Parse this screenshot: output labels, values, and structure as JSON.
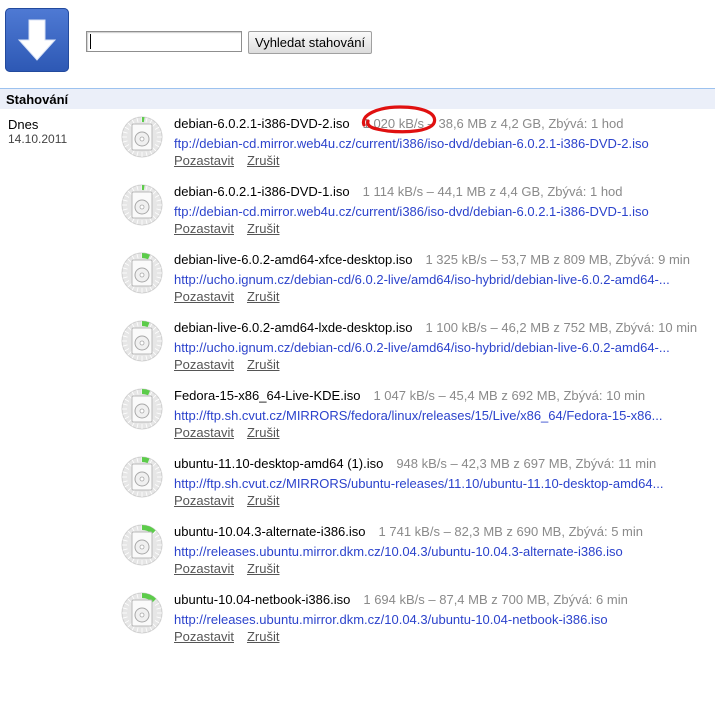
{
  "search": {
    "value": "",
    "button_label": "Vyhledat stahování"
  },
  "section": {
    "title": "Stahování"
  },
  "date_group": {
    "label": "Dnes",
    "date": "14.10.2011"
  },
  "progress_color": "#5ccc4a",
  "annotation_color": "#e01010",
  "downloads": [
    {
      "filename": "debian-6.0.2.1-i386-DVD-2.iso",
      "status": "1 020 kB/s – 38,6 MB z 4,2 GB, Zbývá: 1 hod",
      "url": "ftp://debian-cd.mirror.web4u.cz/current/i386/iso-dvd/debian-6.0.2.1-i386-DVD-2.iso",
      "pause_label": "Pozastavit",
      "cancel_label": "Zrušit",
      "progress": 0.009
    },
    {
      "filename": "debian-6.0.2.1-i386-DVD-1.iso",
      "status": "1 114 kB/s – 44,1 MB z 4,4 GB, Zbývá: 1 hod",
      "url": "ftp://debian-cd.mirror.web4u.cz/current/i386/iso-dvd/debian-6.0.2.1-i386-DVD-1.iso",
      "pause_label": "Pozastavit",
      "cancel_label": "Zrušit",
      "progress": 0.01
    },
    {
      "filename": "debian-live-6.0.2-amd64-xfce-desktop.iso",
      "status": "1 325 kB/s – 53,7 MB z 809 MB, Zbývá: 9 min",
      "url": "http://ucho.ignum.cz/debian-cd/6.0.2-live/amd64/iso-hybrid/debian-live-6.0.2-amd64-...",
      "pause_label": "Pozastavit",
      "cancel_label": "Zrušit",
      "progress": 0.066
    },
    {
      "filename": "debian-live-6.0.2-amd64-lxde-desktop.iso",
      "status": "1 100 kB/s – 46,2 MB z 752 MB, Zbývá: 10 min",
      "url": "http://ucho.ignum.cz/debian-cd/6.0.2-live/amd64/iso-hybrid/debian-live-6.0.2-amd64-...",
      "pause_label": "Pozastavit",
      "cancel_label": "Zrušit",
      "progress": 0.061
    },
    {
      "filename": "Fedora-15-x86_64-Live-KDE.iso",
      "status": "1 047 kB/s – 45,4 MB z 692 MB, Zbývá: 10 min",
      "url": "http://ftp.sh.cvut.cz/MIRRORS/fedora/linux/releases/15/Live/x86_64/Fedora-15-x86...",
      "pause_label": "Pozastavit",
      "cancel_label": "Zrušit",
      "progress": 0.066
    },
    {
      "filename": "ubuntu-11.10-desktop-amd64 (1).iso",
      "status": "948 kB/s – 42,3 MB z 697 MB, Zbývá: 11 min",
      "url": "http://ftp.sh.cvut.cz/MIRRORS/ubuntu-releases/11.10/ubuntu-11.10-desktop-amd64...",
      "pause_label": "Pozastavit",
      "cancel_label": "Zrušit",
      "progress": 0.061
    },
    {
      "filename": "ubuntu-10.04.3-alternate-i386.iso",
      "status": "1 741 kB/s – 82,3 MB z 690 MB, Zbývá: 5 min",
      "url": "http://releases.ubuntu.mirror.dkm.cz/10.04.3/ubuntu-10.04.3-alternate-i386.iso",
      "pause_label": "Pozastavit",
      "cancel_label": "Zrušit",
      "progress": 0.119
    },
    {
      "filename": "ubuntu-10.04-netbook-i386.iso",
      "status": "1 694 kB/s – 87,4 MB z 700 MB, Zbývá: 6 min",
      "url": "http://releases.ubuntu.mirror.dkm.cz/10.04.3/ubuntu-10.04-netbook-i386.iso",
      "pause_label": "Pozastavit",
      "cancel_label": "Zrušit",
      "progress": 0.125
    }
  ]
}
